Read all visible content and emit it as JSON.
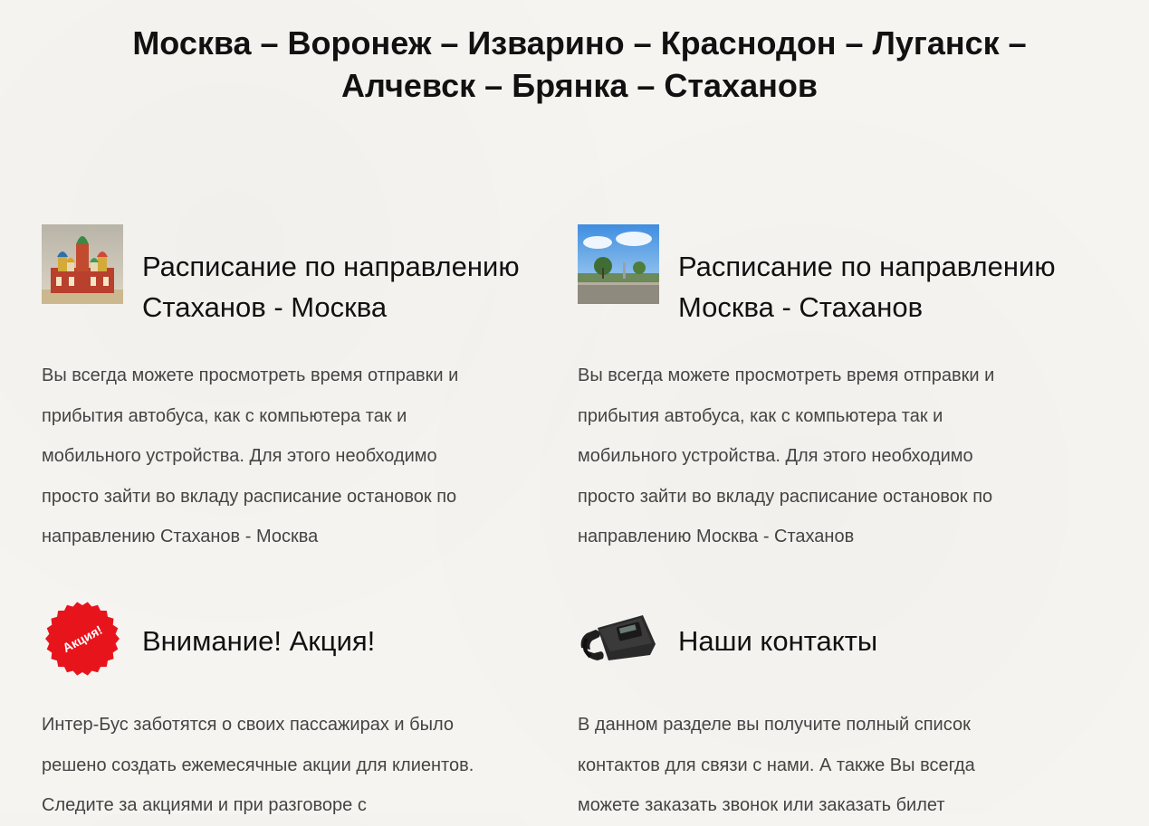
{
  "header": {
    "title_line1": "Москва – Воронеж – Изварино – Краснодон – Луганск –",
    "title_line2": "Алчевск – Брянка – Стаханов"
  },
  "blocks": [
    {
      "icon": "kremlin-cathedral-photo",
      "title_line1": "Расписание по направлению",
      "title_line2": "Стаханов - Москва",
      "text_lines": [
        "Вы всегда можете просмотреть время отправки и",
        "прибытия автобуса, как с компьютера так и",
        "мобильного устройства. Для этого необходимо",
        "просто зайти во вкладу расписание остановок по",
        "направлению Стаханов - Москва"
      ]
    },
    {
      "icon": "city-square-photo",
      "title_line1": "Расписание по направлению",
      "title_line2": "Москва - Стаханов",
      "text_lines": [
        "Вы всегда можете просмотреть время отправки и",
        "прибытия автобуса, как с компьютера так и",
        "мобильного устройства. Для этого необходимо",
        "просто зайти во вкладу расписание остановок по",
        "направлению Москва - Стаханов"
      ]
    },
    {
      "icon": "promo-badge-icon",
      "badge_text": "Акция!",
      "badge_color": "#e8141c",
      "title_line1": "Внимание! Акция!",
      "text_lines": [
        "Интер-Бус заботятся о своих пассажирах и было",
        "решено создать ежемесячные акции для клиентов.",
        "Следите за акциями и при разговоре с"
      ]
    },
    {
      "icon": "telephone-icon",
      "title_line1": "Наши контакты",
      "text_lines": [
        "В данном разделе вы получите полный список",
        "контактов для связи с нами. А также Вы всегда",
        "можете заказать звонок или заказать билет"
      ]
    }
  ]
}
